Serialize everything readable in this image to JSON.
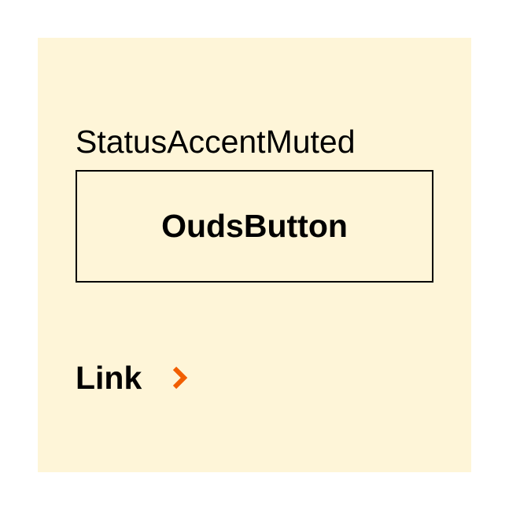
{
  "colors": {
    "page_background": "#ffffff",
    "panel_background": "#fef5d8",
    "text": "#000000",
    "button_border": "#000000",
    "link_chevron": "#f15e00"
  },
  "panel": {
    "title": "StatusAccentMuted"
  },
  "button": {
    "label": "OudsButton"
  },
  "link": {
    "label": "Link",
    "icon": "chevron-right-icon"
  }
}
